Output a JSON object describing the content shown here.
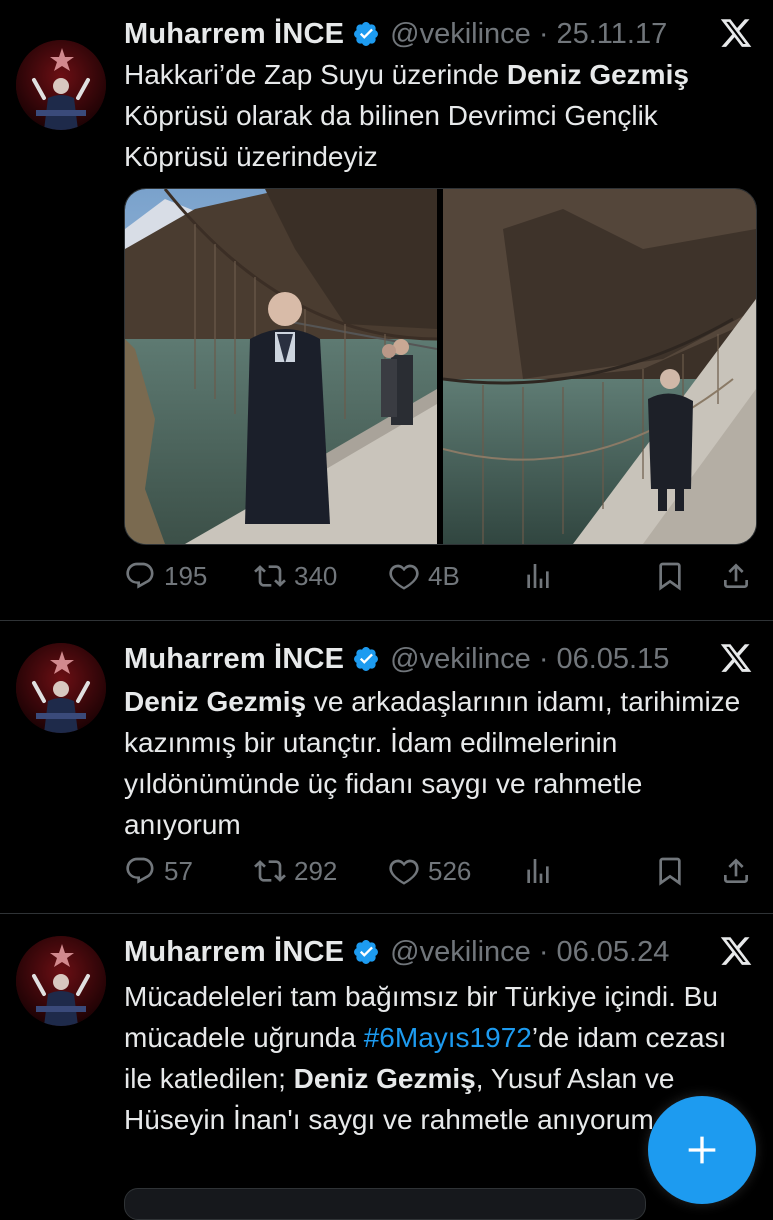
{
  "colors": {
    "background": "#000000",
    "text": "#e7e9ea",
    "muted": "#71767b",
    "accent": "#1d9bf0",
    "divider": "#2f3336"
  },
  "tweets": [
    {
      "name": "Muharrem İNCE",
      "handle": "@vekilince",
      "separator": "·",
      "date": "25.11.17",
      "text": {
        "p1": "Hakkari’de Zap Suyu üzerinde ",
        "b1": "Deniz Gezmiş",
        "p2": " Köprüsü olarak da bilinen Devrimci Gençlik Köprüsü üzerindeyiz"
      },
      "media": {
        "count": 2,
        "icon": "photo-icon"
      },
      "stats": {
        "replies": "195",
        "retweets": "340",
        "likes": "4B"
      }
    },
    {
      "name": "Muharrem İNCE",
      "handle": "@vekilince",
      "separator": "·",
      "date": "06.05.15",
      "text": {
        "b1": "Deniz Gezmiş",
        "p1": " ve arkadaşlarının idamı, tarihimize kazınmış bir utançtır. İdam edilmelerinin yıldönümünde üç fidanı saygı ve rahmetle anıyorum"
      },
      "stats": {
        "replies": "57",
        "retweets": "292",
        "likes": "526"
      }
    },
    {
      "name": "Muharrem İNCE",
      "handle": "@vekilince",
      "separator": "·",
      "date": "06.05.24",
      "text": {
        "p1": "Mücadeleleri tam bağımsız bir Türkiye içindi. Bu mücadele uğrunda ",
        "hashtag": "#6Mayıs1972",
        "p2": "’de idam cezası ile katledilen; ",
        "b1": "Deniz Gezmiş",
        "p3": ", Yusuf Aslan ve Hüseyin İnan'ı saygı ve rahmetle anıyorum."
      }
    }
  ],
  "fab": {
    "icon": "plus-icon"
  }
}
